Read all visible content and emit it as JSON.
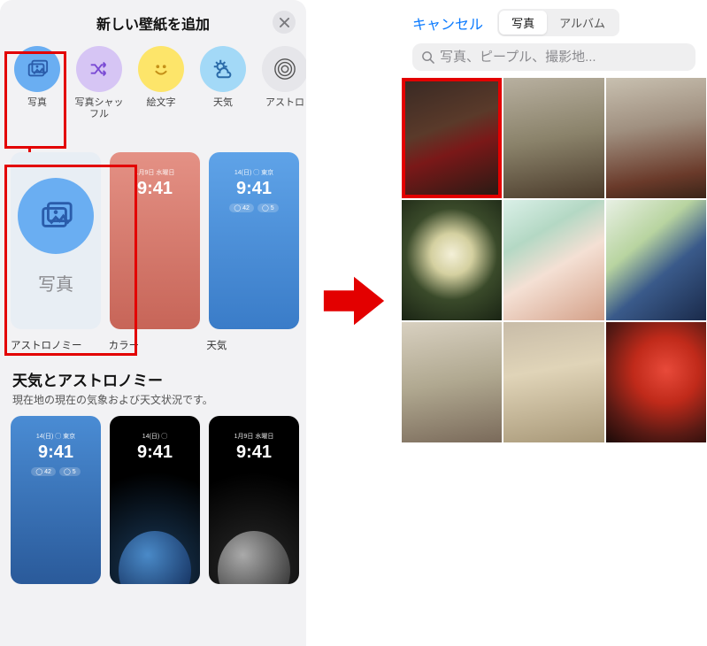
{
  "left": {
    "title": "新しい壁紙を追加",
    "categories": [
      {
        "label": "写真"
      },
      {
        "label": "写真シャッフル"
      },
      {
        "label": "絵文字"
      },
      {
        "label": "天気"
      },
      {
        "label": "アストロ"
      }
    ],
    "wall_tiles": {
      "photo_label": "写真",
      "captions": {
        "astro": "アストロノミー",
        "color": "カラー",
        "weather": "天気"
      },
      "time": "9:41",
      "date_tokyo": "14(日) ◯ 東京",
      "date_wed": "1月9日 水曜日"
    },
    "section": {
      "title": "天気とアストロノミー",
      "subtitle": "現在地の現在の気象および天文状況です。"
    },
    "bottom_tiles": {
      "time": "9:41",
      "date1": "14(日) ◯ 東京",
      "date2": "14(日) ◯",
      "date3": "1月9日 水曜日",
      "widget_temp": "◯ 42",
      "widget_cond": "◯ 5"
    }
  },
  "right": {
    "cancel": "キャンセル",
    "tabs": {
      "photos": "写真",
      "albums": "アルバム"
    },
    "search_placeholder": "写真、ピープル、撮影地..."
  }
}
